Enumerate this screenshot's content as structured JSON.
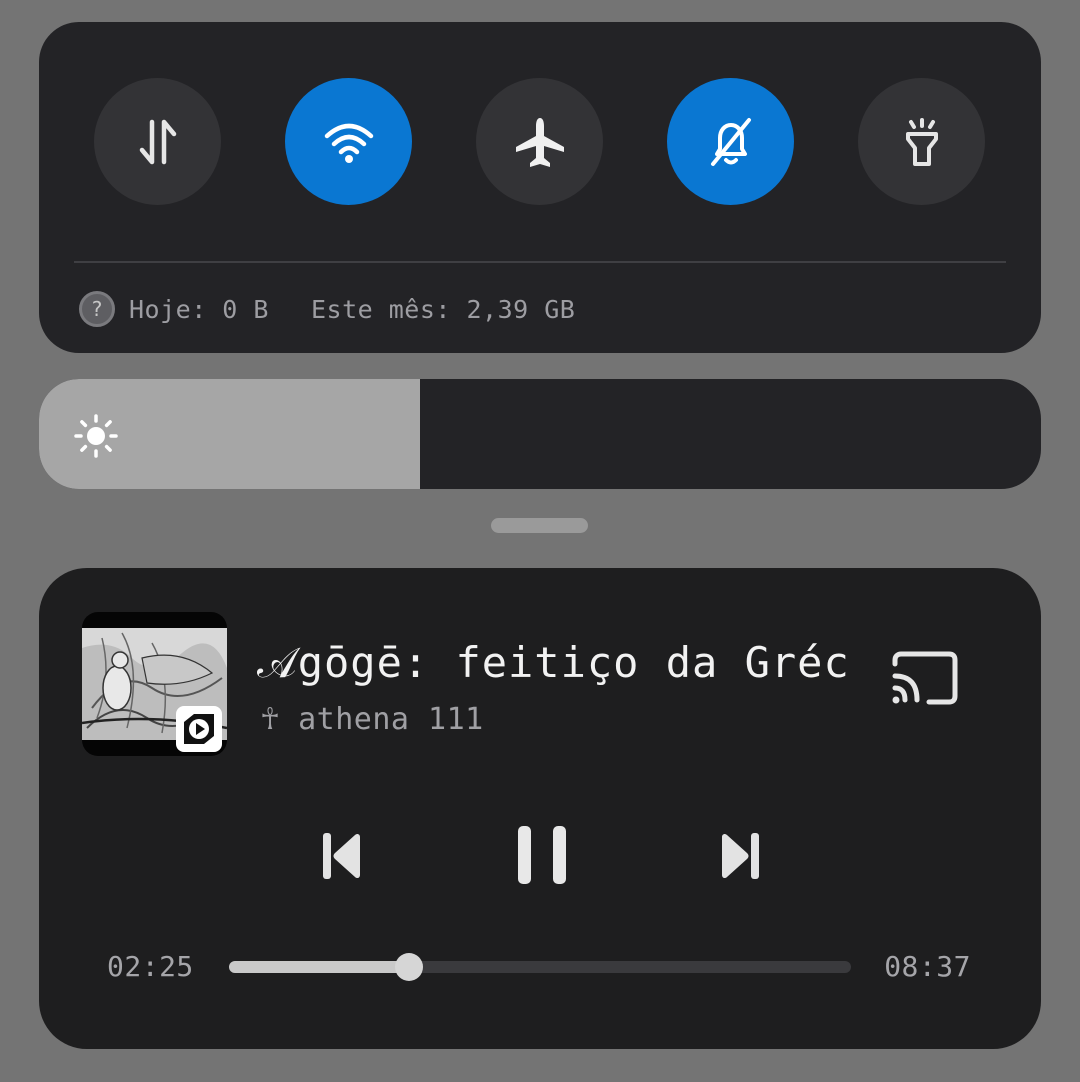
{
  "quick_settings": {
    "toggles": [
      {
        "name": "mobile-data",
        "icon": "data-transfer-arrows-icon",
        "active": false
      },
      {
        "name": "wifi",
        "icon": "wifi-icon",
        "active": true
      },
      {
        "name": "airplane-mode",
        "icon": "airplane-icon",
        "active": false
      },
      {
        "name": "do-not-disturb",
        "icon": "bell-off-icon",
        "active": true
      },
      {
        "name": "flashlight",
        "icon": "flashlight-icon",
        "active": false
      }
    ],
    "data_usage": {
      "help_icon_glyph": "?",
      "today": "Hoje: 0 B",
      "month": "Este mês: 2,39 GB"
    }
  },
  "brightness": {
    "level": 0.38,
    "icon": "sun-icon"
  },
  "media": {
    "title": "𝒜gōgē: feitiço da Gréc...",
    "artist": "☥ athena 111",
    "elapsed": "02:25",
    "duration": "08:37",
    "progress": 0.29,
    "cast_icon": "cast-icon",
    "app_badge_icon": "play-app-icon"
  },
  "colors": {
    "active_toggle": "#0a77d2",
    "inactive_toggle": "#333336",
    "panel": "#232326",
    "background": "#747474"
  }
}
